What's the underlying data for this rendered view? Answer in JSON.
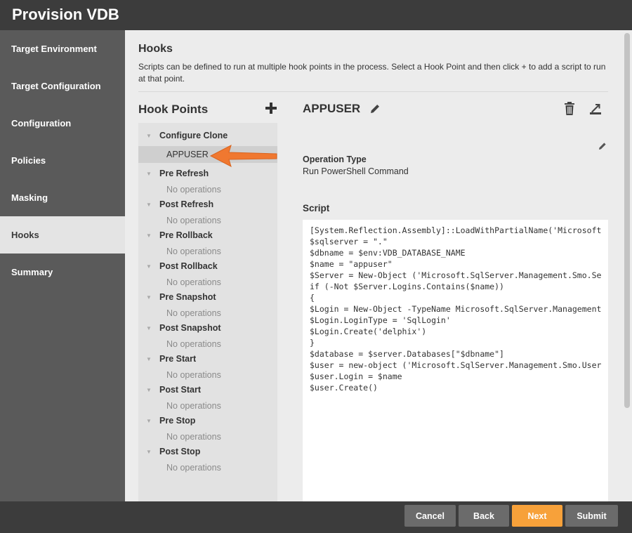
{
  "window": {
    "title": "Provision VDB"
  },
  "sidebar": {
    "items": [
      {
        "label": "Target Environment"
      },
      {
        "label": "Target Configuration"
      },
      {
        "label": "Configuration"
      },
      {
        "label": "Policies"
      },
      {
        "label": "Masking"
      },
      {
        "label": "Hooks",
        "active": true
      },
      {
        "label": "Summary"
      }
    ]
  },
  "main": {
    "title": "Hooks",
    "description": "Scripts can be defined to run at multiple hook points in the process. Select a Hook Point and then click + to add a script to run at that point.",
    "hook_points": {
      "title": "Hook Points",
      "add_icon": "plus-icon",
      "groups": [
        {
          "label": "Configure Clone",
          "operation": "APPUSER",
          "selected": true
        },
        {
          "label": "Pre Refresh",
          "operation": "No operations"
        },
        {
          "label": "Post Refresh",
          "operation": "No operations"
        },
        {
          "label": "Pre Rollback",
          "operation": "No operations"
        },
        {
          "label": "Post Rollback",
          "operation": "No operations"
        },
        {
          "label": "Pre Snapshot",
          "operation": "No operations"
        },
        {
          "label": "Post Snapshot",
          "operation": "No operations"
        },
        {
          "label": "Pre Start",
          "operation": "No operations"
        },
        {
          "label": "Post Start",
          "operation": "No operations"
        },
        {
          "label": "Pre Stop",
          "operation": "No operations"
        },
        {
          "label": "Post Stop",
          "operation": "No operations"
        }
      ]
    },
    "operation": {
      "name": "APPUSER",
      "type_label": "Operation Type",
      "type_value": "Run PowerShell Command",
      "script_label": "Script",
      "script_lines": [
        "[System.Reflection.Assembly]::LoadWithPartialName('Microsoft",
        "$sqlserver = \".\"",
        "$dbname = $env:VDB_DATABASE_NAME",
        "$name = \"appuser\"",
        "$Server = New-Object ('Microsoft.SqlServer.Management.Smo.Se",
        "if (-Not $Server.Logins.Contains($name))",
        "{",
        "$Login = New-Object -TypeName Microsoft.SqlServer.Management",
        "$Login.LoginType = 'SqlLogin'",
        "$Login.Create('delphix')",
        "}",
        "$database = $server.Databases[\"$dbname\"]",
        "$user = new-object ('Microsoft.SqlServer.Management.Smo.User",
        "$user.Login = $name",
        "$user.Create()"
      ]
    }
  },
  "footer": {
    "cancel_label": "Cancel",
    "back_label": "Back",
    "next_label": "Next",
    "submit_label": "Submit"
  },
  "colors": {
    "accent": "#f7a13a",
    "annotation_arrow": "#f07830",
    "header_bg": "#3c3c3c",
    "sidebar_bg": "#5a5a5a"
  }
}
